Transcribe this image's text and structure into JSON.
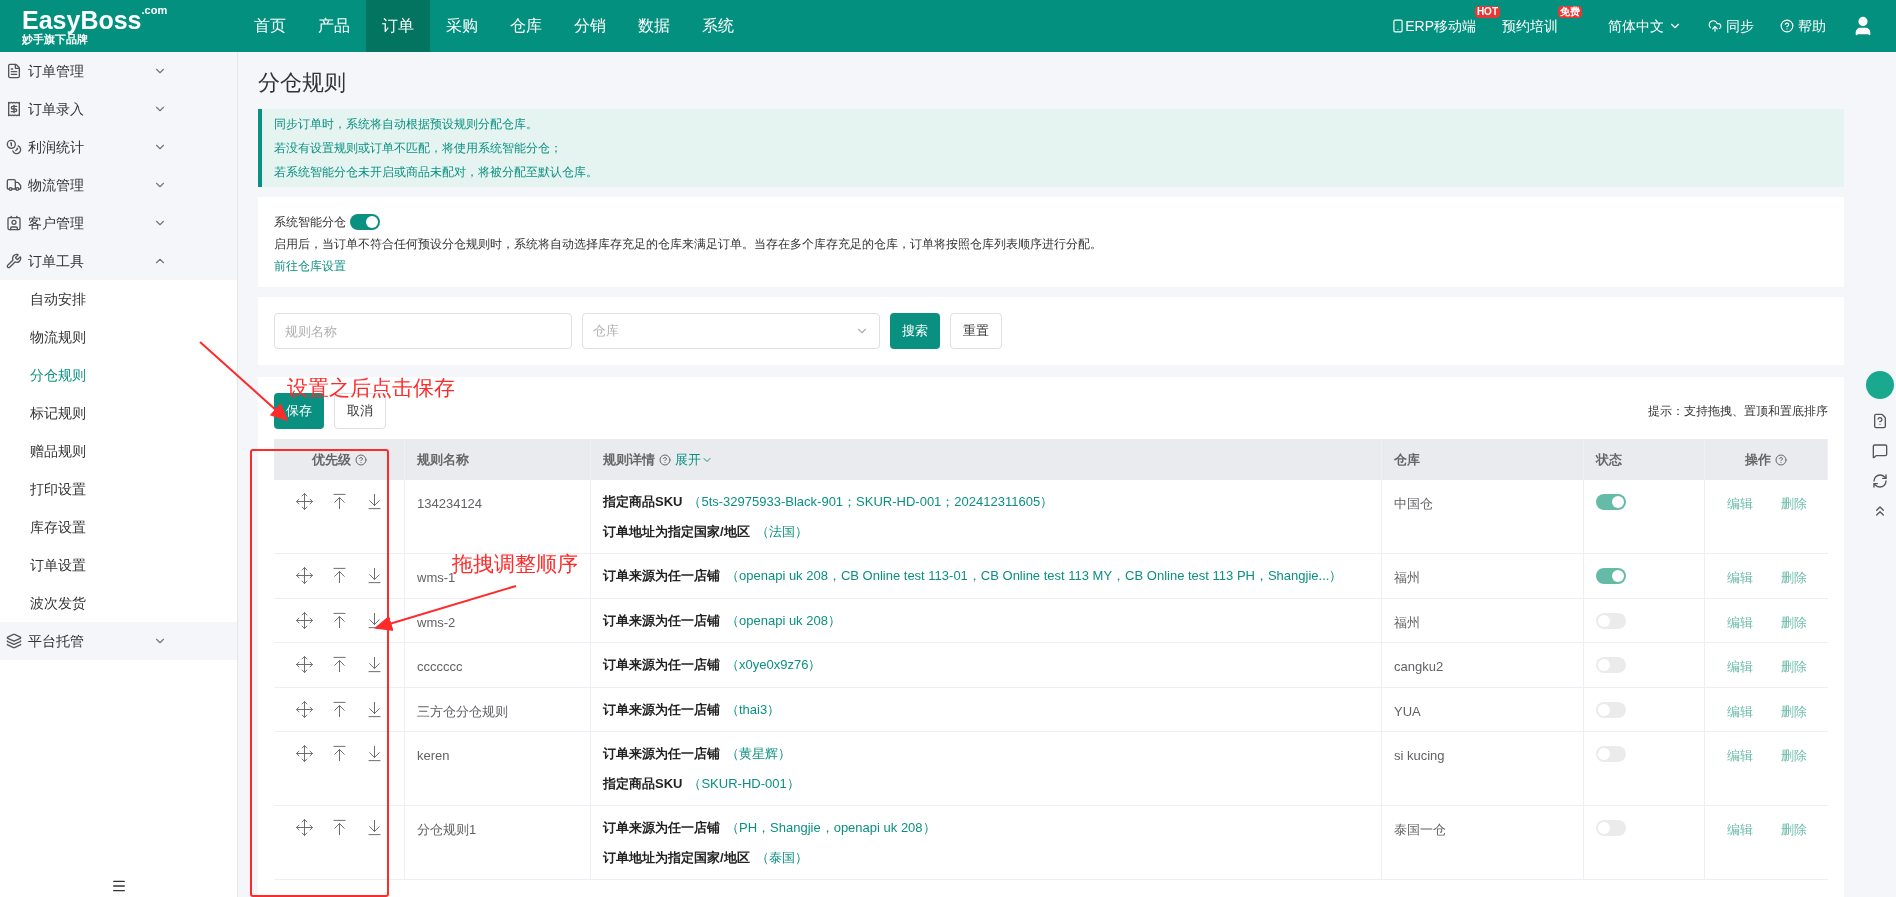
{
  "logo": {
    "name": "EasyBoss",
    "suffix": ".com",
    "tagline": "妙手旗下品牌"
  },
  "nav": [
    {
      "label": "首页",
      "selected": false
    },
    {
      "label": "产品",
      "selected": false
    },
    {
      "label": "订单",
      "selected": true
    },
    {
      "label": "采购",
      "selected": false
    },
    {
      "label": "仓库",
      "selected": false
    },
    {
      "label": "分销",
      "selected": false
    },
    {
      "label": "数据",
      "selected": false
    },
    {
      "label": "系统",
      "selected": false
    }
  ],
  "top_right": [
    {
      "kind": "mobile",
      "label": "ERP移动端",
      "badge": "HOT"
    },
    {
      "kind": "badge",
      "label": "预约培训",
      "badge": "免费"
    },
    {
      "kind": "dropdown",
      "label": "简体中文"
    },
    {
      "kind": "sync",
      "label": "同步"
    },
    {
      "kind": "help",
      "label": "帮助"
    },
    {
      "kind": "user"
    }
  ],
  "sidebar": [
    {
      "label": "订单管理",
      "expanded": false
    },
    {
      "label": "订单录入",
      "expanded": false
    },
    {
      "label": "利润统计",
      "expanded": false
    },
    {
      "label": "物流管理",
      "expanded": false
    },
    {
      "label": "客户管理",
      "expanded": false
    },
    {
      "label": "订单工具",
      "expanded": true,
      "children": [
        {
          "label": "自动安排",
          "selected": false
        },
        {
          "label": "物流规则",
          "selected": false
        },
        {
          "label": "分仓规则",
          "selected": true
        },
        {
          "label": "标记规则",
          "selected": false
        },
        {
          "label": "赠品规则",
          "selected": false
        },
        {
          "label": "打印设置",
          "selected": false
        },
        {
          "label": "库存设置",
          "selected": false
        },
        {
          "label": "订单设置",
          "selected": false
        },
        {
          "label": "波次发货",
          "selected": false
        }
      ]
    },
    {
      "label": "平台托管",
      "expanded": false
    }
  ],
  "page_title": "分仓规则",
  "notice": [
    "同步订单时，系统将自动根据预设规则分配仓库。",
    "若没有设置规则或订单不匹配，将使用系统智能分仓；",
    "若系统智能分仓未开启或商品未配对，将被分配至默认仓库。"
  ],
  "smart": {
    "label": "系统智能分仓",
    "on": true,
    "description": "启用后，当订单不符合任何预设分仓规则时，系统将自动选择库存充足的仓库来满足订单。当存在多个库存充足的仓库，订单将按照仓库列表顺序进行分配。",
    "link": "前往仓库设置"
  },
  "search": {
    "name_placeholder": "规则名称",
    "warehouse_placeholder": "仓库",
    "search_button": "搜索",
    "reset_button": "重置"
  },
  "actions": {
    "save": "保存",
    "cancel": "取消",
    "hint": "提示：支持拖拽、置顶和置底排序"
  },
  "table": {
    "columns": [
      "优先级",
      "规则名称",
      "规则详情",
      "仓库",
      "状态",
      "操作"
    ],
    "expand": "展开",
    "rows": [
      {
        "name": "134234124",
        "details": [
          {
            "label": "指定商品SKU",
            "value": "（5ts-32975933-Black-901；SKUR-HD-001；202412311605）"
          },
          {
            "label": "订单地址为指定国家/地区",
            "value": "（法国）"
          }
        ],
        "warehouse": "中国仓",
        "enabled": true,
        "edit": "编辑",
        "delete": "删除"
      },
      {
        "name": "wms-1",
        "details": [
          {
            "label": "订单来源为任一店铺",
            "value": "（openapi uk 208，CB Online test 113-01，CB Online test 113 MY，CB Online test 113 PH，Shangjie...）"
          }
        ],
        "warehouse": "福州",
        "enabled": true,
        "edit": "编辑",
        "delete": "删除"
      },
      {
        "name": "wms-2",
        "details": [
          {
            "label": "订单来源为任一店铺",
            "value": "（openapi uk 208）"
          }
        ],
        "warehouse": "福州",
        "enabled": false,
        "edit": "编辑",
        "delete": "删除"
      },
      {
        "name": "ccccccc",
        "details": [
          {
            "label": "订单来源为任一店铺",
            "value": "（x0ye0x9z76）"
          }
        ],
        "warehouse": "cangku2",
        "enabled": false,
        "edit": "编辑",
        "delete": "删除"
      },
      {
        "name": "三方仓分仓规则",
        "details": [
          {
            "label": "订单来源为任一店铺",
            "value": "（thai3）"
          }
        ],
        "warehouse": "YUA",
        "enabled": false,
        "edit": "编辑",
        "delete": "删除"
      },
      {
        "name": "keren",
        "details": [
          {
            "label": "订单来源为任一店铺",
            "value": "（黄星辉）"
          },
          {
            "label": "指定商品SKU",
            "value": "（SKUR-HD-001）"
          }
        ],
        "warehouse": "si kucing",
        "enabled": false,
        "edit": "编辑",
        "delete": "删除"
      },
      {
        "name": "分仓规则1",
        "details": [
          {
            "label": "订单来源为任一店铺",
            "value": "（PH，Shangjie，openapi uk 208）"
          },
          {
            "label": "订单地址为指定国家/地区",
            "value": "（泰国）"
          }
        ],
        "warehouse": "泰国一仓",
        "enabled": false,
        "edit": "编辑",
        "delete": "删除"
      }
    ]
  },
  "annotations": [
    "设置之后点击保存",
    "拖拽调整顺序"
  ]
}
